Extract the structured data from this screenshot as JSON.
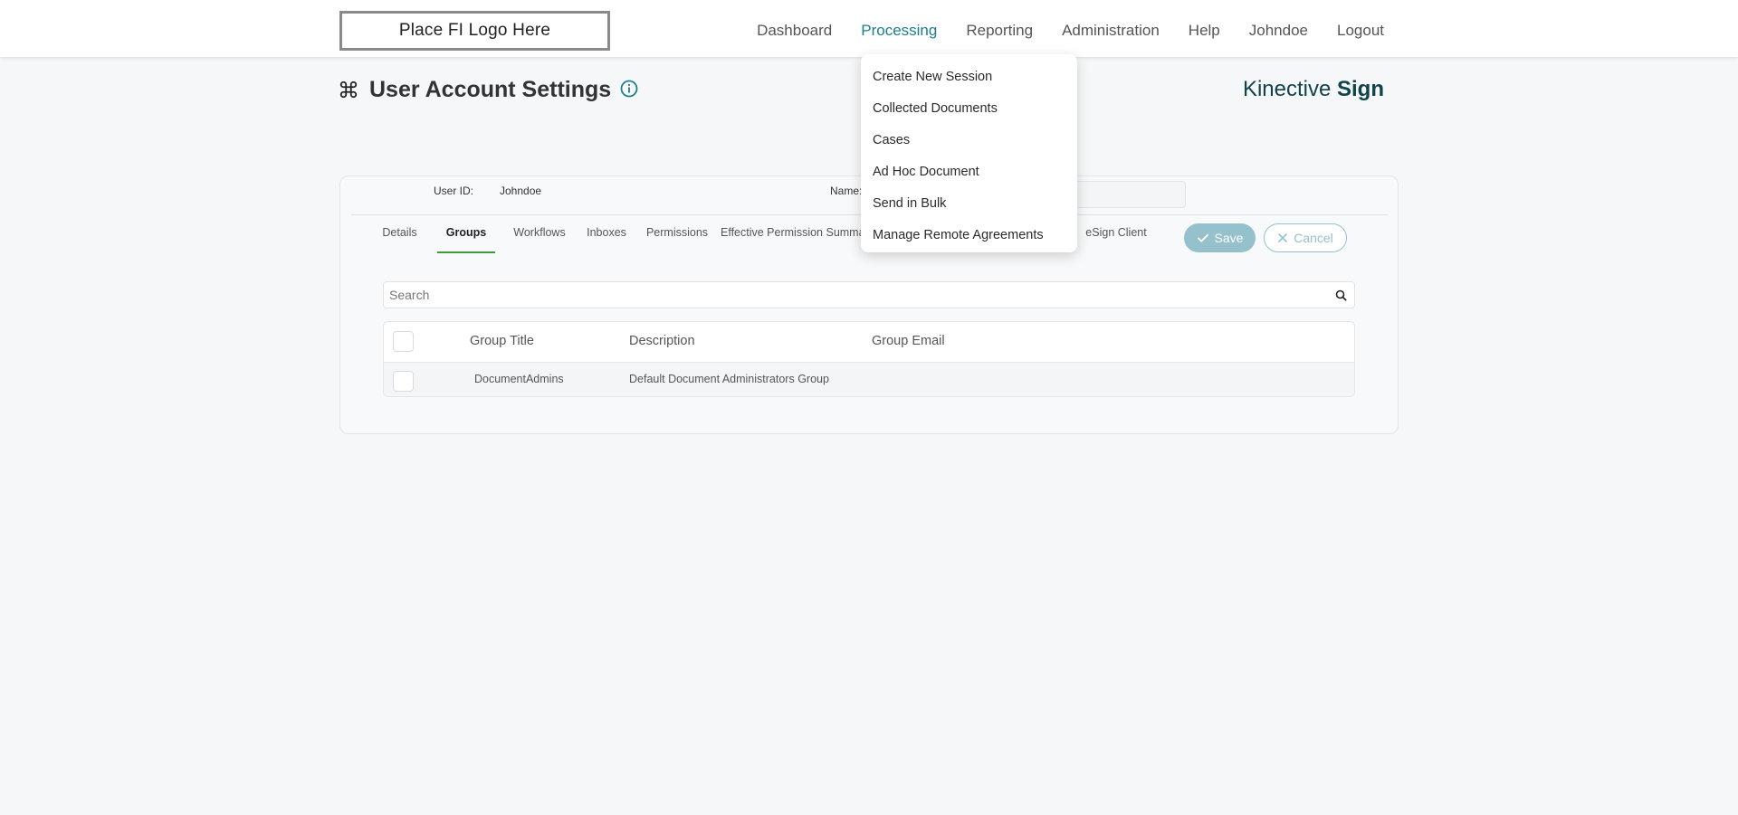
{
  "header": {
    "logo_text": "Place FI Logo Here",
    "nav": [
      "Dashboard",
      "Processing",
      "Reporting",
      "Administration",
      "Help",
      "Johndoe",
      "Logout"
    ],
    "active_nav": "Processing",
    "accent_color": "#1b7f8c"
  },
  "dropdown": {
    "items": [
      "Create New Session",
      "Collected Documents",
      "Cases",
      "Ad Hoc Document",
      "Send in Bulk",
      "Manage Remote Agreements"
    ]
  },
  "page": {
    "title": "User Account Settings",
    "title_icon": "command-icon",
    "info_icon": "info-icon",
    "brand_light": "Kinective",
    "brand_bold": "Sign"
  },
  "user": {
    "id_label": "User ID:",
    "id_value": "Johndoe",
    "name_label": "Name:"
  },
  "tabs": {
    "items": [
      "Details",
      "Groups",
      "Workflows",
      "Inboxes",
      "Permissions",
      "Effective Permission Summary",
      "eSign Client"
    ],
    "active": "Groups",
    "active_underline_color": "#3d9b3d"
  },
  "actions": {
    "save_label": "Save",
    "cancel_label": "Cancel",
    "button_color": "#95c1cc"
  },
  "search": {
    "placeholder": "Search",
    "value": ""
  },
  "table": {
    "columns": [
      "Group Title",
      "Description",
      "Group Email"
    ],
    "rows": [
      {
        "title": "DocumentAdmins",
        "description": "Default Document Administrators Group",
        "email": ""
      }
    ]
  }
}
